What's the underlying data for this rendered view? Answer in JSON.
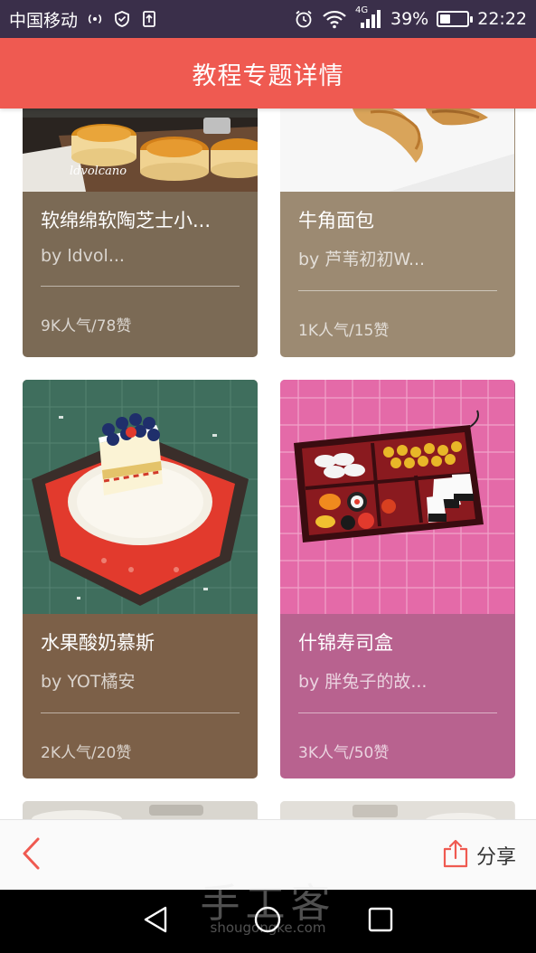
{
  "status_bar": {
    "carrier": "中国移动",
    "network": "4G",
    "battery_percent_text": "39%",
    "battery_level": 0.39,
    "time": "22:22"
  },
  "header": {
    "title": "教程专题详情"
  },
  "cards": [
    {
      "title": "软绵绵软陶芝士小...",
      "author": "by ldvol...",
      "stats": "9K人气/78赞",
      "color": "#7b6a55",
      "photo_text": "ldvolcano"
    },
    {
      "title": "牛角面包",
      "author": "by 芦苇初初W...",
      "stats": "1K人气/15赞",
      "color": "#9c8a72"
    },
    {
      "title": "水果酸奶慕斯",
      "author": "by YOT橘安",
      "stats": "2K人气/20赞",
      "color": "#7c6048"
    },
    {
      "title": "什锦寿司盒",
      "author": "by 胖兔子的故...",
      "stats": "3K人气/50赞",
      "color": "#b8628f"
    }
  ],
  "bottom_bar": {
    "share_label": "分享"
  },
  "watermark": {
    "big": "手工客",
    "small": "shougongke.com"
  }
}
